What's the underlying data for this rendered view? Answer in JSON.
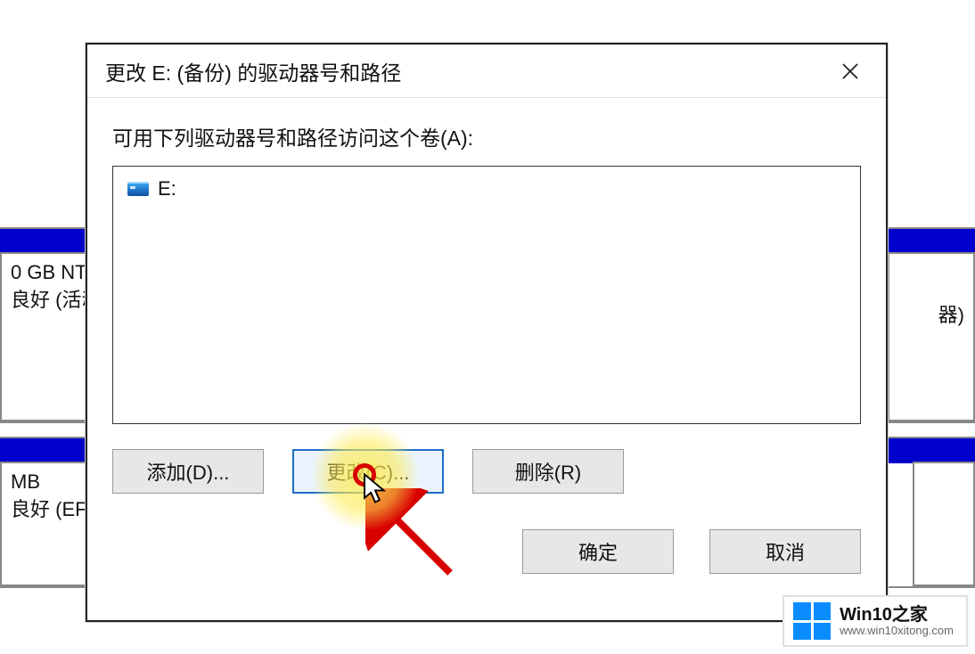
{
  "dialog": {
    "title": "更改 E: (备份) 的驱动器号和路径",
    "description": "可用下列驱动器号和路径访问这个卷(A):",
    "list_items": [
      {
        "label": "E:"
      }
    ],
    "buttons": {
      "add": "添加(D)...",
      "change": "更改(C)...",
      "remove": "删除(R)",
      "ok": "确定",
      "cancel": "取消"
    }
  },
  "background": {
    "vol1_line1": "0 GB NT",
    "vol1_line2": "良好 (活动",
    "vol2_line1": "MB",
    "vol2_line2": "良好 (EFI 系",
    "vol3_suffix": "器)"
  },
  "watermark": {
    "title": "Win10之家",
    "url": "www.win10xitong.com"
  },
  "colors": {
    "accent_blue": "#1a6fc4",
    "strip_blue": "#0000cc"
  }
}
